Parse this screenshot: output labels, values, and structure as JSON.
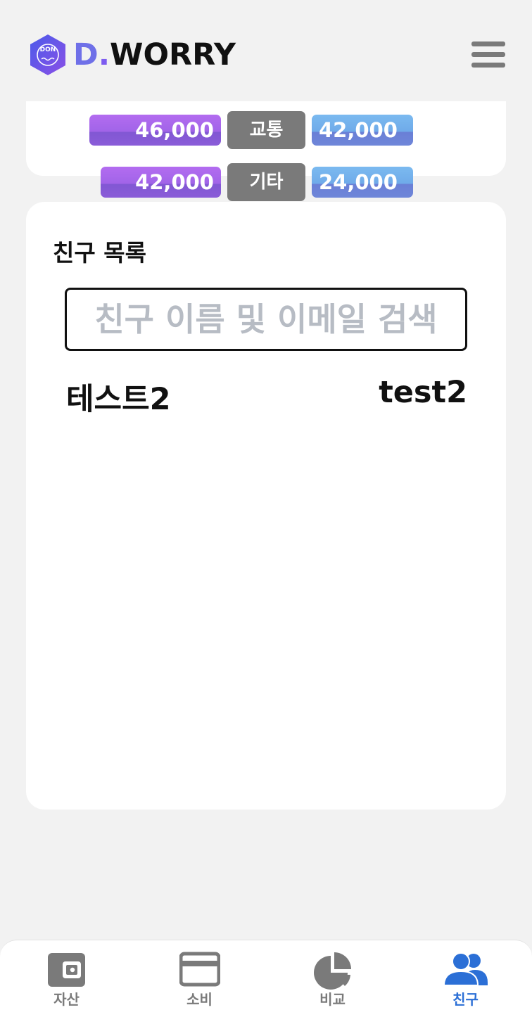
{
  "header": {
    "logo_badge": "DON",
    "logo_d": "D",
    "logo_dot": ".",
    "logo_rest": "WORRY",
    "menu_icon": "hamburger-menu-icon"
  },
  "comparison": {
    "rows": [
      {
        "category": "교통",
        "left_value": "46,000",
        "right_value": "42,000"
      },
      {
        "category": "기타",
        "left_value": "42,000",
        "right_value": "24,000"
      }
    ]
  },
  "friends": {
    "title": "친구 목록",
    "search_placeholder": "친구 이름 및 이메일 검색",
    "items": [
      {
        "name": "테스트2",
        "email": "test2"
      }
    ]
  },
  "bottom_nav": {
    "items": [
      {
        "label": "자산",
        "icon": "wallet-icon"
      },
      {
        "label": "소비",
        "icon": "credit-card-icon"
      },
      {
        "label": "비교",
        "icon": "pie-chart-icon"
      },
      {
        "label": "친구",
        "icon": "users-icon",
        "active": true
      }
    ],
    "active_color": "#2b6fd6",
    "inactive_color": "#7a7a7a"
  }
}
